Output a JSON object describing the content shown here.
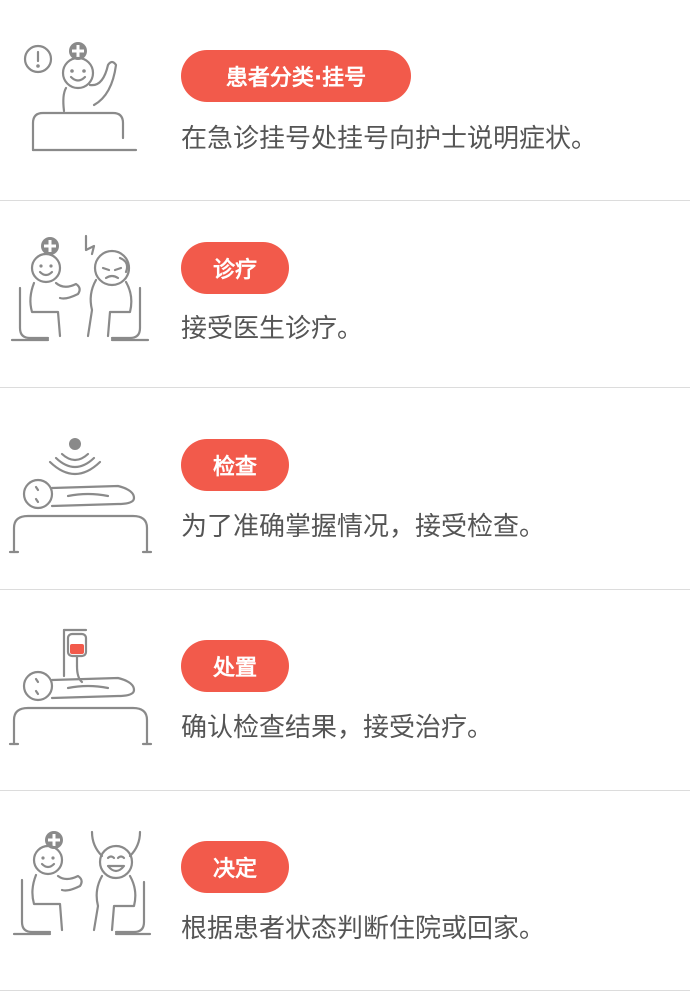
{
  "steps": [
    {
      "title": "患者分类·挂号",
      "desc": "在急诊挂号处挂号向护士说明症状。",
      "icon": "patient-registration-icon"
    },
    {
      "title": "诊疗",
      "desc": "接受医生诊疗。",
      "icon": "doctor-consultation-icon"
    },
    {
      "title": "检查",
      "desc": "为了准确掌握情况，接受检查。",
      "icon": "scan-examination-icon"
    },
    {
      "title": "处置",
      "desc": "确认检查结果，接受治疗。",
      "icon": "iv-treatment-icon"
    },
    {
      "title": "决定",
      "desc": "根据患者状态判断住院或回家。",
      "icon": "discharge-decision-icon"
    }
  ],
  "colors": {
    "accent": "#f25a4b",
    "text": "#555555",
    "icon": "#8a8a8a",
    "divider": "#dcdcdc"
  }
}
